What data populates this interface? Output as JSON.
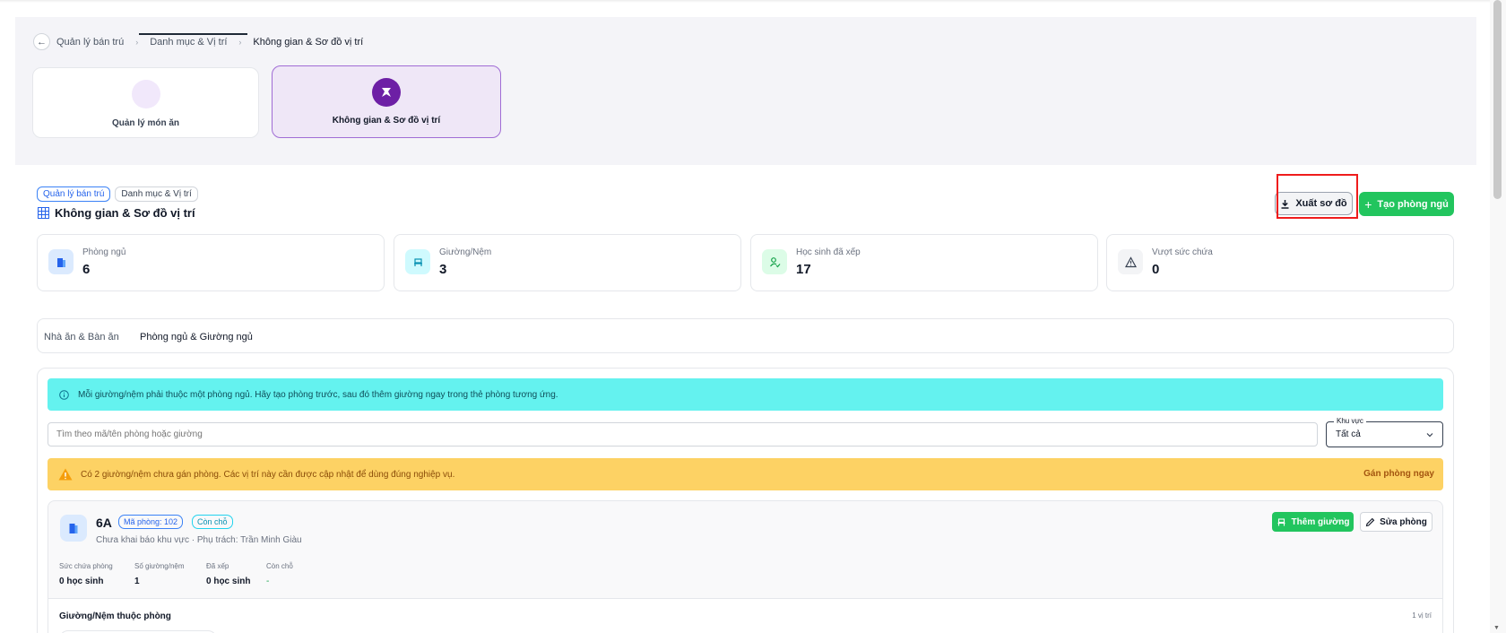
{
  "breadcrumb": {
    "items": [
      "Quản lý bán trú",
      "Danh mục & Vị trí",
      "Không gian & Sơ đồ vị trí"
    ],
    "separator": "›"
  },
  "modules": [
    {
      "label": "Quản lý món ăn",
      "active": false
    },
    {
      "label": "Không gian & Sơ đồ vị trí",
      "active": true
    }
  ],
  "header": {
    "chips": [
      "Quản lý bán trú",
      "Danh mục & Vị trí"
    ],
    "title": "Không gian & Sơ đồ vị trí",
    "export_label": "Xuất sơ đồ",
    "create_label": "Tạo phòng ngủ"
  },
  "stats": [
    {
      "label": "Phòng ngủ",
      "value": "6",
      "color": "#2563eb",
      "bg": "#dbeafe"
    },
    {
      "label": "Giường/Nệm",
      "value": "3",
      "color": "#0891b2",
      "bg": "#cffafe"
    },
    {
      "label": "Học sinh đã xếp",
      "value": "17",
      "color": "#16a34a",
      "bg": "#dcfce7"
    },
    {
      "label": "Vượt sức chứa",
      "value": "0",
      "color": "#374151",
      "bg": "#f3f4f6"
    }
  ],
  "tabs": [
    {
      "label": "Nhà ăn & Bàn ăn",
      "active": false
    },
    {
      "label": "Phòng ngủ & Giường ngủ",
      "active": true
    }
  ],
  "info_banner": "Mỗi giường/nệm phải thuộc một phòng ngủ. Hãy tạo phòng trước, sau đó thêm giường ngay trong thẻ phòng tương ứng.",
  "search": {
    "placeholder": "Tìm theo mã/tên phòng hoặc giường",
    "value": ""
  },
  "area_filter": {
    "legend": "Khu vực",
    "value": "Tất cả"
  },
  "warning": {
    "text": "Có 2 giường/nệm chưa gán phòng. Các vị trí này cần được cập nhật để dùng đúng nghiệp vụ.",
    "action": "Gán phòng ngay"
  },
  "room": {
    "name": "6A",
    "code": "Mã phòng: 102",
    "status": "Còn chỗ",
    "description": "Chưa khai báo khu vực · Phụ trách: Trần Minh Giàu",
    "add_bed_label": "Thêm giường",
    "edit_label": "Sửa phòng",
    "metrics": [
      {
        "label": "Sức chứa phòng",
        "value": "0 học sinh"
      },
      {
        "label": "Số giường/nệm",
        "value": "1"
      },
      {
        "label": "Đã xếp",
        "value": "0 học sinh"
      },
      {
        "label": "Còn chỗ",
        "value": "-"
      }
    ],
    "beds_title": "Giường/Nệm thuộc phòng",
    "beds_count": "1 vị trí"
  },
  "colors": {
    "accent_green": "#22c55e",
    "accent_purple": "#6d1fa5",
    "info_bg": "#64f2ef",
    "warn_bg": "#fdd264",
    "highlight_red": "#ef1c1c"
  }
}
